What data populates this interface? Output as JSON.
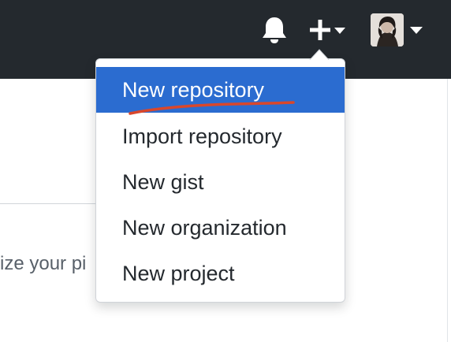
{
  "header": {
    "notifications_icon": "bell-icon",
    "create_icon": "plus-icon",
    "create_caret_icon": "caret-down-icon",
    "avatar_caret_icon": "caret-down-icon",
    "bar_color": "#24292e"
  },
  "dropdown": {
    "items": [
      {
        "label": "New repository",
        "selected": true
      },
      {
        "label": "Import repository",
        "selected": false
      },
      {
        "label": "New gist",
        "selected": false
      },
      {
        "label": "New organization",
        "selected": false
      },
      {
        "label": "New project",
        "selected": false
      }
    ],
    "selected_color": "#2b6cd0",
    "annotation_color": "#d9472b"
  },
  "background": {
    "partial_text": "ize your pi"
  }
}
